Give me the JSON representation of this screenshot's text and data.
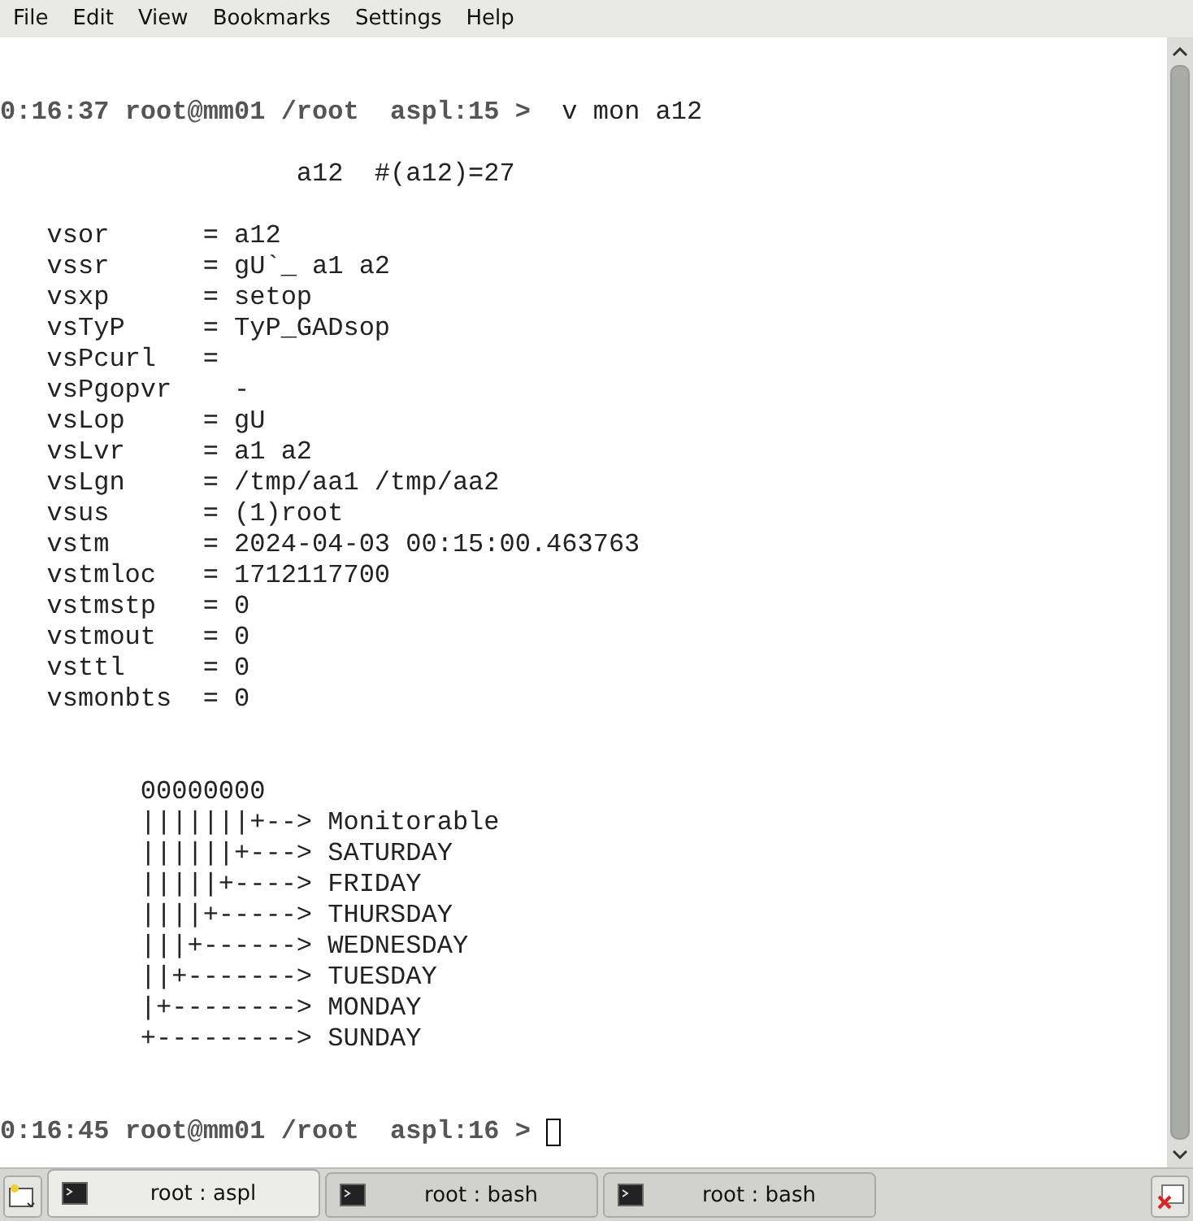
{
  "menu": [
    "File",
    "Edit",
    "View",
    "Bookmarks",
    "Settings",
    "Help"
  ],
  "terminal": {
    "prompt_1": {
      "prompt": "0:16:37 root@mm01 /root  aspl:15 >",
      "command": "v mon a12"
    },
    "header": "a12  #(a12)=27",
    "fields": [
      {
        "name": "vsor",
        "value": "= a12",
        "kind": "assign"
      },
      {
        "name": "vssr",
        "value": "= gU`_ a1 a2",
        "kind": "assign"
      },
      {
        "name": "vsxp",
        "value": "= setop",
        "kind": "assign"
      },
      {
        "name": "vsTyP",
        "value": "= TyP_GADsop",
        "kind": "assign"
      },
      {
        "name": "vsPcurl",
        "value": "=",
        "kind": "assign"
      },
      {
        "name": "vsPgopvr",
        "value": "-",
        "kind": "dash"
      },
      {
        "name": "vsLop",
        "value": "= gU",
        "kind": "assign"
      },
      {
        "name": "vsLvr",
        "value": "= a1 a2",
        "kind": "assign"
      },
      {
        "name": "vsLgn",
        "value": "= /tmp/aa1 /tmp/aa2",
        "kind": "assign"
      },
      {
        "name": "vsus",
        "value": "= (1)root",
        "kind": "assign"
      },
      {
        "name": "vstm",
        "value": "= 2024-04-03 00:15:00.463763",
        "kind": "assign"
      },
      {
        "name": "vstmloc",
        "value": "= 1712117700",
        "kind": "assign"
      },
      {
        "name": "vstmstp",
        "value": "= 0",
        "kind": "assign"
      },
      {
        "name": "vstmout",
        "value": "= 0",
        "kind": "assign"
      },
      {
        "name": "vsttl",
        "value": "= 0",
        "kind": "assign"
      },
      {
        "name": "vsmonbts",
        "value": "= 0",
        "kind": "assign"
      }
    ],
    "diagram": [
      "00000000",
      "|||||||+--> Monitorable",
      "||||||+---> SATURDAY",
      "|||||+----> FRIDAY",
      "||||+-----> THURSDAY",
      "|||+------> WEDNESDAY",
      "||+-------> TUESDAY",
      "|+--------> MONDAY",
      "+---------> SUNDAY"
    ],
    "prompt_2": {
      "prompt": "0:16:45 root@mm01 /root  aspl:16 >"
    }
  },
  "tabs": [
    {
      "label": "root : aspl",
      "selected": true
    },
    {
      "label": "root : bash",
      "selected": false
    },
    {
      "label": "root : bash",
      "selected": false
    }
  ]
}
